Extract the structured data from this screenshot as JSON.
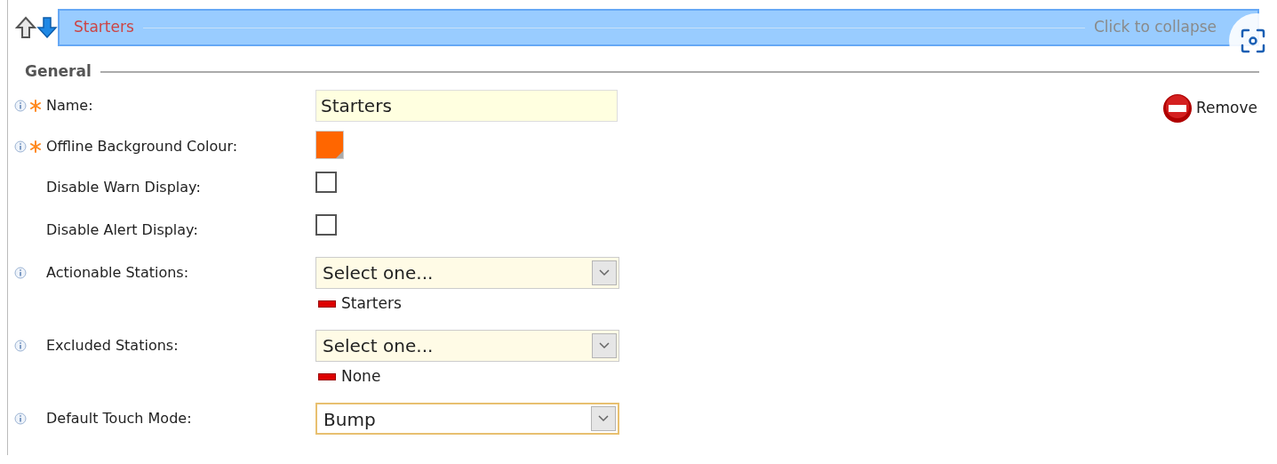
{
  "header": {
    "title": "Starters",
    "hint": "Click to collapse"
  },
  "section": "General",
  "remove": "Remove",
  "fields": [
    {
      "kind": "text",
      "label": "Name:",
      "info": true,
      "required": true,
      "value": "Starters"
    },
    {
      "kind": "color",
      "label": "Offline Background Colour:",
      "info": true,
      "required": true,
      "color": "#ff6600"
    },
    {
      "kind": "checkbox",
      "label": "Disable Warn Display:",
      "info": false,
      "required": false,
      "checked": false
    },
    {
      "kind": "checkbox",
      "label": "Disable Alert Display:",
      "info": false,
      "required": false,
      "checked": false
    },
    {
      "kind": "select",
      "label": "Actionable Stations:",
      "info": true,
      "required": false,
      "placeholder": "Select one...",
      "focused": false,
      "tags": [
        "Starters"
      ]
    },
    {
      "kind": "select",
      "label": "Excluded Stations:",
      "info": true,
      "required": false,
      "placeholder": "Select one...",
      "focused": false,
      "tags": [
        "None"
      ]
    },
    {
      "kind": "select",
      "label": "Default Touch Mode:",
      "info": true,
      "required": false,
      "value": "Bump",
      "focused": true
    }
  ]
}
